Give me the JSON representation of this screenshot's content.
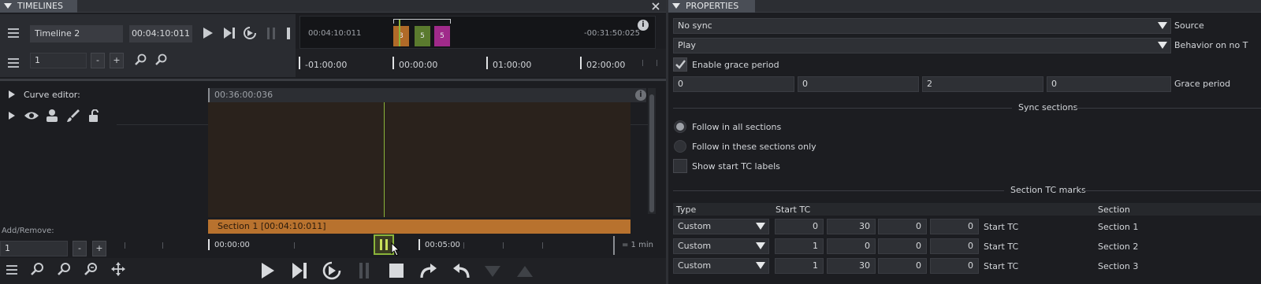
{
  "timelines_panel": {
    "title": "TIMELINES",
    "timeline_name": "Timeline 2",
    "current_tc": "00:04:10:011",
    "overview_start": "00:04:10:011",
    "overview_end": "-00:31:50:025",
    "section_badges": [
      "3",
      "5",
      "5"
    ],
    "zoom_value": "1",
    "zoom_minus": "-",
    "zoom_plus": "+",
    "ruler_labels": [
      "-01:00:00",
      "00:00:00",
      "01:00:00",
      "02:00:00"
    ],
    "curve_editor_label": "Curve editor:",
    "track_tc": "00:36:00:036",
    "section_bar_label": "Section 1 [00:04:10:011]",
    "add_remove_label": "Add/Remove:",
    "add_remove_value": "1",
    "bottom_ruler": [
      "00:00:00",
      "00:05:00"
    ],
    "scale_label": "= 1 min"
  },
  "properties_panel": {
    "title": "PROPERTIES",
    "source_value": "No sync",
    "source_label": "Source",
    "behavior_value": "Play",
    "behavior_label": "Behavior on no T",
    "grace_enable_label": "Enable grace period",
    "grace_values": [
      "0",
      "0",
      "2",
      "0"
    ],
    "grace_label": "Grace period",
    "sync_sections_title": "Sync sections",
    "radio_all_label": "Follow in all sections",
    "radio_these_label": "Follow in these sections only",
    "show_start_label": "Show start TC labels",
    "tc_marks_title": "Section TC marks",
    "col_type": "Type",
    "col_start": "Start TC",
    "col_section": "Section",
    "rows": [
      {
        "type": "Custom",
        "h": "0",
        "m": "30",
        "s": "0",
        "f": "0",
        "label": "Start TC",
        "section": "Section 1"
      },
      {
        "type": "Custom",
        "h": "1",
        "m": "0",
        "s": "0",
        "f": "0",
        "label": "Start TC",
        "section": "Section 2"
      },
      {
        "type": "Custom",
        "h": "1",
        "m": "30",
        "s": "0",
        "f": "0",
        "label": "Start TC",
        "section": "Section 3"
      }
    ]
  },
  "colors": {
    "section_orange": "#b8722e",
    "badge_orange": "#b06a28",
    "badge_green": "#5a7a2e",
    "badge_magenta": "#a02a8a",
    "playhead": "#8ab43a"
  }
}
